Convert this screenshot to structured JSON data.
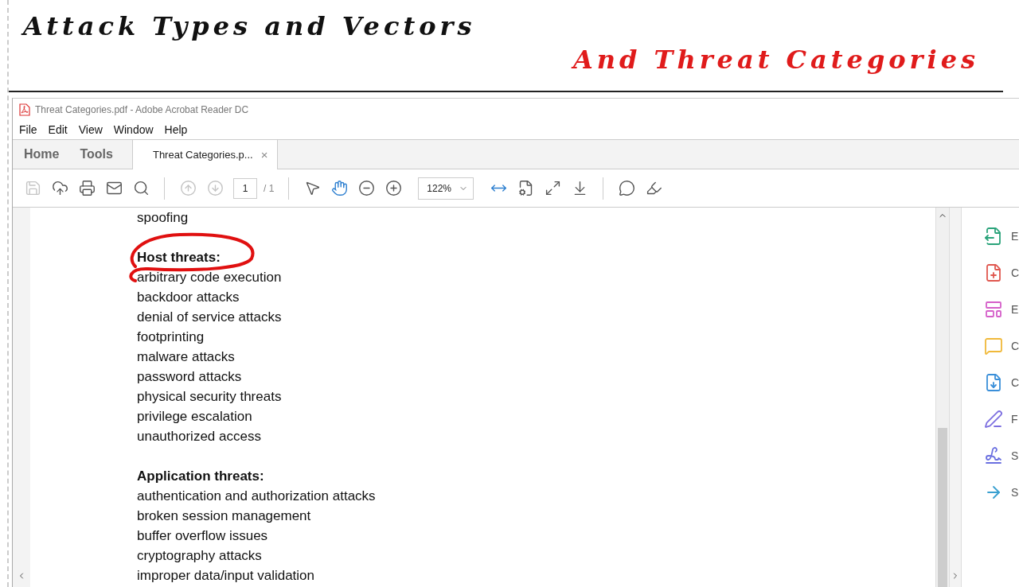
{
  "header": {
    "title": "Attack Types and Vectors",
    "subtitle": "And Threat Categories"
  },
  "window": {
    "title": "Threat Categories.pdf - Adobe Acrobat Reader DC"
  },
  "menu": [
    "File",
    "Edit",
    "View",
    "Window",
    "Help"
  ],
  "tabs": [
    {
      "label": "Home",
      "selected": false
    },
    {
      "label": "Tools",
      "selected": false
    },
    {
      "label": "Threat Categories.p...",
      "selected": true,
      "close": "×"
    }
  ],
  "toolbar": [
    {
      "kind": "save",
      "disabled": true,
      "active": false
    },
    {
      "kind": "upload",
      "disabled": false,
      "active": false
    },
    {
      "kind": "print",
      "disabled": false,
      "active": false
    },
    {
      "kind": "mail",
      "disabled": false,
      "active": false
    },
    {
      "kind": "search",
      "disabled": false,
      "active": false
    },
    {
      "kind": "separator"
    },
    {
      "kind": "prev",
      "disabled": true,
      "active": false
    },
    {
      "kind": "next",
      "disabled": true,
      "active": false
    },
    {
      "kind": "page",
      "value": "1",
      "total": "/ 1"
    },
    {
      "kind": "separator"
    },
    {
      "kind": "select",
      "disabled": false,
      "active": false
    },
    {
      "kind": "hand",
      "disabled": false,
      "active": true
    },
    {
      "kind": "zoom-out",
      "disabled": false,
      "active": false
    },
    {
      "kind": "zoom-in",
      "disabled": false,
      "active": false
    },
    {
      "kind": "zoom",
      "value": "122%"
    },
    {
      "kind": "fit-width",
      "disabled": false,
      "active": true
    },
    {
      "kind": "fit-page",
      "disabled": false,
      "active": false
    },
    {
      "kind": "fullscreen",
      "disabled": false,
      "active": false
    },
    {
      "kind": "scroll-mode",
      "disabled": false,
      "active": false
    },
    {
      "kind": "separator"
    },
    {
      "kind": "comment",
      "disabled": false,
      "active": false
    },
    {
      "kind": "highlight",
      "disabled": false,
      "active": false
    }
  ],
  "document": [
    {
      "kind": "item",
      "text": "spoofing"
    },
    {
      "kind": "gap"
    },
    {
      "kind": "heading",
      "text": "Host threats:",
      "circled": true
    },
    {
      "kind": "item",
      "text": "arbitrary code execution"
    },
    {
      "kind": "item",
      "text": "backdoor attacks"
    },
    {
      "kind": "item",
      "text": "denial of service attacks"
    },
    {
      "kind": "item",
      "text": "footprinting"
    },
    {
      "kind": "item",
      "text": "malware attacks"
    },
    {
      "kind": "item",
      "text": "password attacks"
    },
    {
      "kind": "item",
      "text": "physical security threats"
    },
    {
      "kind": "item",
      "text": "privilege escalation"
    },
    {
      "kind": "item",
      "text": "unauthorized access"
    },
    {
      "kind": "gap"
    },
    {
      "kind": "heading",
      "text": "Application threats:",
      "circled": false
    },
    {
      "kind": "item",
      "text": "authentication and authorization attacks"
    },
    {
      "kind": "item",
      "text": "broken session management"
    },
    {
      "kind": "item",
      "text": "buffer overflow issues"
    },
    {
      "kind": "item",
      "text": "cryptography attacks"
    },
    {
      "kind": "item",
      "text": "improper data/input validation"
    }
  ],
  "tools_panel": [
    {
      "kind": "export",
      "label": "E",
      "color": "#2aa37a"
    },
    {
      "kind": "create",
      "label": "C",
      "color": "#e0574f"
    },
    {
      "kind": "edit",
      "label": "E",
      "color": "#d55fc9"
    },
    {
      "kind": "comment",
      "label": "C",
      "color": "#f0b93a"
    },
    {
      "kind": "combine",
      "label": "C",
      "color": "#3a8fd9"
    },
    {
      "kind": "fill-sign",
      "label": "F",
      "color": "#7d6fe0"
    },
    {
      "kind": "sign",
      "label": "S",
      "color": "#6a6fe0"
    },
    {
      "kind": "send",
      "label": "S",
      "color": "#3aa0d0"
    }
  ]
}
